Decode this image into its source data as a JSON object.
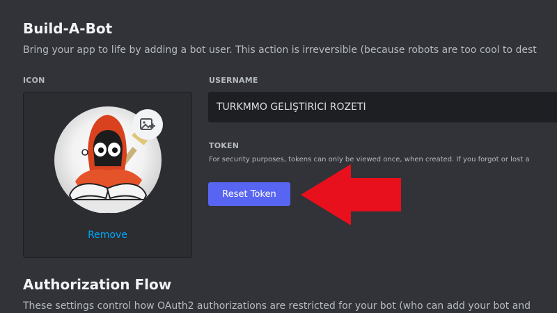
{
  "build_a_bot": {
    "title": "Build-A-Bot",
    "description": "Bring your app to life by adding a bot user. This action is irreversible (because robots are too cool to dest"
  },
  "icon_section": {
    "label": "ICON",
    "upload_icon": "image-add-icon",
    "remove_label": "Remove"
  },
  "username_section": {
    "label": "USERNAME",
    "value": "TURKMMO GELİŞTİRİCİ ROZETİ"
  },
  "token_section": {
    "label": "TOKEN",
    "note": "For security purposes, tokens can only be viewed once, when created. If you forgot or lost a",
    "reset_label": "Reset Token"
  },
  "annotation": {
    "arrow_color": "#e8101c"
  },
  "authorization_flow": {
    "title": "Authorization Flow",
    "description": "These settings control how OAuth2 authorizations are restricted for your bot (who can add your bot and"
  },
  "colors": {
    "background": "#313338",
    "accent": "#5865f2",
    "link": "#00a8fc"
  }
}
